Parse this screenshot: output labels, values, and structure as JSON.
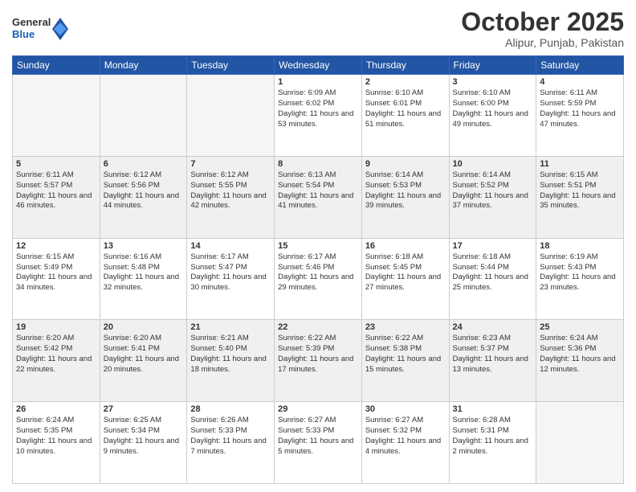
{
  "logo": {
    "general": "General",
    "blue": "Blue"
  },
  "title": {
    "month": "October 2025",
    "location": "Alipur, Punjab, Pakistan"
  },
  "days_of_week": [
    "Sunday",
    "Monday",
    "Tuesday",
    "Wednesday",
    "Thursday",
    "Friday",
    "Saturday"
  ],
  "weeks": [
    [
      {
        "day": "",
        "info": ""
      },
      {
        "day": "",
        "info": ""
      },
      {
        "day": "",
        "info": ""
      },
      {
        "day": "1",
        "info": "Sunrise: 6:09 AM\nSunset: 6:02 PM\nDaylight: 11 hours and 53 minutes."
      },
      {
        "day": "2",
        "info": "Sunrise: 6:10 AM\nSunset: 6:01 PM\nDaylight: 11 hours and 51 minutes."
      },
      {
        "day": "3",
        "info": "Sunrise: 6:10 AM\nSunset: 6:00 PM\nDaylight: 11 hours and 49 minutes."
      },
      {
        "day": "4",
        "info": "Sunrise: 6:11 AM\nSunset: 5:59 PM\nDaylight: 11 hours and 47 minutes."
      }
    ],
    [
      {
        "day": "5",
        "info": "Sunrise: 6:11 AM\nSunset: 5:57 PM\nDaylight: 11 hours and 46 minutes."
      },
      {
        "day": "6",
        "info": "Sunrise: 6:12 AM\nSunset: 5:56 PM\nDaylight: 11 hours and 44 minutes."
      },
      {
        "day": "7",
        "info": "Sunrise: 6:12 AM\nSunset: 5:55 PM\nDaylight: 11 hours and 42 minutes."
      },
      {
        "day": "8",
        "info": "Sunrise: 6:13 AM\nSunset: 5:54 PM\nDaylight: 11 hours and 41 minutes."
      },
      {
        "day": "9",
        "info": "Sunrise: 6:14 AM\nSunset: 5:53 PM\nDaylight: 11 hours and 39 minutes."
      },
      {
        "day": "10",
        "info": "Sunrise: 6:14 AM\nSunset: 5:52 PM\nDaylight: 11 hours and 37 minutes."
      },
      {
        "day": "11",
        "info": "Sunrise: 6:15 AM\nSunset: 5:51 PM\nDaylight: 11 hours and 35 minutes."
      }
    ],
    [
      {
        "day": "12",
        "info": "Sunrise: 6:15 AM\nSunset: 5:49 PM\nDaylight: 11 hours and 34 minutes."
      },
      {
        "day": "13",
        "info": "Sunrise: 6:16 AM\nSunset: 5:48 PM\nDaylight: 11 hours and 32 minutes."
      },
      {
        "day": "14",
        "info": "Sunrise: 6:17 AM\nSunset: 5:47 PM\nDaylight: 11 hours and 30 minutes."
      },
      {
        "day": "15",
        "info": "Sunrise: 6:17 AM\nSunset: 5:46 PM\nDaylight: 11 hours and 29 minutes."
      },
      {
        "day": "16",
        "info": "Sunrise: 6:18 AM\nSunset: 5:45 PM\nDaylight: 11 hours and 27 minutes."
      },
      {
        "day": "17",
        "info": "Sunrise: 6:18 AM\nSunset: 5:44 PM\nDaylight: 11 hours and 25 minutes."
      },
      {
        "day": "18",
        "info": "Sunrise: 6:19 AM\nSunset: 5:43 PM\nDaylight: 11 hours and 23 minutes."
      }
    ],
    [
      {
        "day": "19",
        "info": "Sunrise: 6:20 AM\nSunset: 5:42 PM\nDaylight: 11 hours and 22 minutes."
      },
      {
        "day": "20",
        "info": "Sunrise: 6:20 AM\nSunset: 5:41 PM\nDaylight: 11 hours and 20 minutes."
      },
      {
        "day": "21",
        "info": "Sunrise: 6:21 AM\nSunset: 5:40 PM\nDaylight: 11 hours and 18 minutes."
      },
      {
        "day": "22",
        "info": "Sunrise: 6:22 AM\nSunset: 5:39 PM\nDaylight: 11 hours and 17 minutes."
      },
      {
        "day": "23",
        "info": "Sunrise: 6:22 AM\nSunset: 5:38 PM\nDaylight: 11 hours and 15 minutes."
      },
      {
        "day": "24",
        "info": "Sunrise: 6:23 AM\nSunset: 5:37 PM\nDaylight: 11 hours and 13 minutes."
      },
      {
        "day": "25",
        "info": "Sunrise: 6:24 AM\nSunset: 5:36 PM\nDaylight: 11 hours and 12 minutes."
      }
    ],
    [
      {
        "day": "26",
        "info": "Sunrise: 6:24 AM\nSunset: 5:35 PM\nDaylight: 11 hours and 10 minutes."
      },
      {
        "day": "27",
        "info": "Sunrise: 6:25 AM\nSunset: 5:34 PM\nDaylight: 11 hours and 9 minutes."
      },
      {
        "day": "28",
        "info": "Sunrise: 6:26 AM\nSunset: 5:33 PM\nDaylight: 11 hours and 7 minutes."
      },
      {
        "day": "29",
        "info": "Sunrise: 6:27 AM\nSunset: 5:33 PM\nDaylight: 11 hours and 5 minutes."
      },
      {
        "day": "30",
        "info": "Sunrise: 6:27 AM\nSunset: 5:32 PM\nDaylight: 11 hours and 4 minutes."
      },
      {
        "day": "31",
        "info": "Sunrise: 6:28 AM\nSunset: 5:31 PM\nDaylight: 11 hours and 2 minutes."
      },
      {
        "day": "",
        "info": ""
      }
    ]
  ]
}
